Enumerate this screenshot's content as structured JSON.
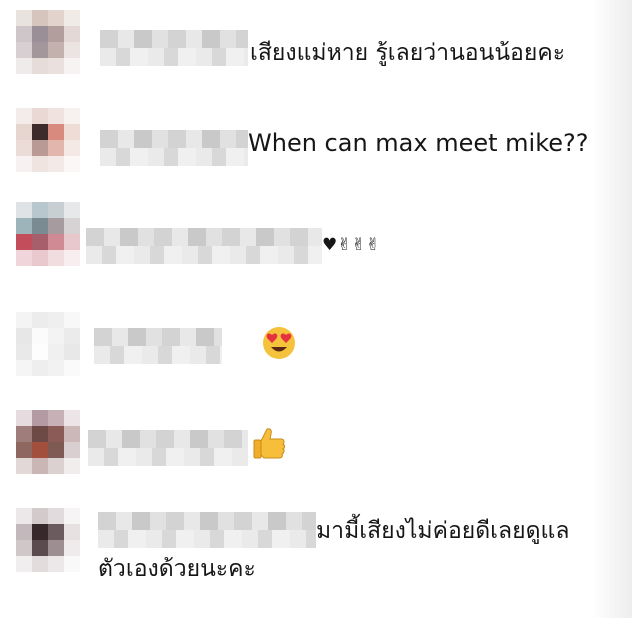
{
  "comments": [
    {
      "text": "เสียงแม่หาย รู้เลยว่านอนน้อยคะ"
    },
    {
      "text": "When can max meet mike??"
    },
    {
      "text": "♥✌✌✌"
    },
    {
      "emoji": "heart-eyes-emoji"
    },
    {
      "emoji": "thumbs-up-emoji"
    },
    {
      "text_line1": "มามี้เสียงไม่ค่อยดีเลยดูแล",
      "text_line2": "ตัวเองด้วยนะคะ"
    }
  ]
}
